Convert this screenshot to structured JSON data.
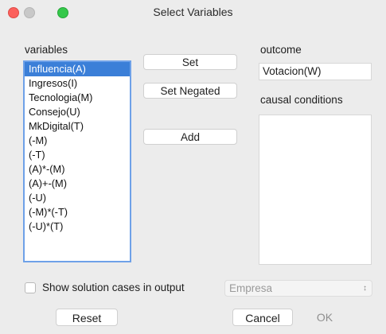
{
  "window": {
    "title": "Select Variables"
  },
  "labels": {
    "variables": "variables",
    "outcome": "outcome",
    "causal_conditions": "causal conditions",
    "show_solution": "Show solution cases in output"
  },
  "variables_list": [
    "Influencia(A)",
    "Ingresos(I)",
    "Tecnologia(M)",
    "Consejo(U)",
    "MkDigital(T)",
    "(-M)",
    "(-T)",
    "(A)*-(M)",
    "(A)+-(M)",
    "(-U)",
    "(-M)*(-T)",
    "(-U)*(T)"
  ],
  "buttons": {
    "set": "Set",
    "set_negated": "Set Negated",
    "add": "Add",
    "reset": "Reset",
    "cancel": "Cancel",
    "ok": "OK"
  },
  "outcome_value": "Votacion(W)",
  "case_select": {
    "value": "Empresa"
  },
  "colors": {
    "selection": "#3b7fd8",
    "focus_ring": "#6ea1e8"
  }
}
